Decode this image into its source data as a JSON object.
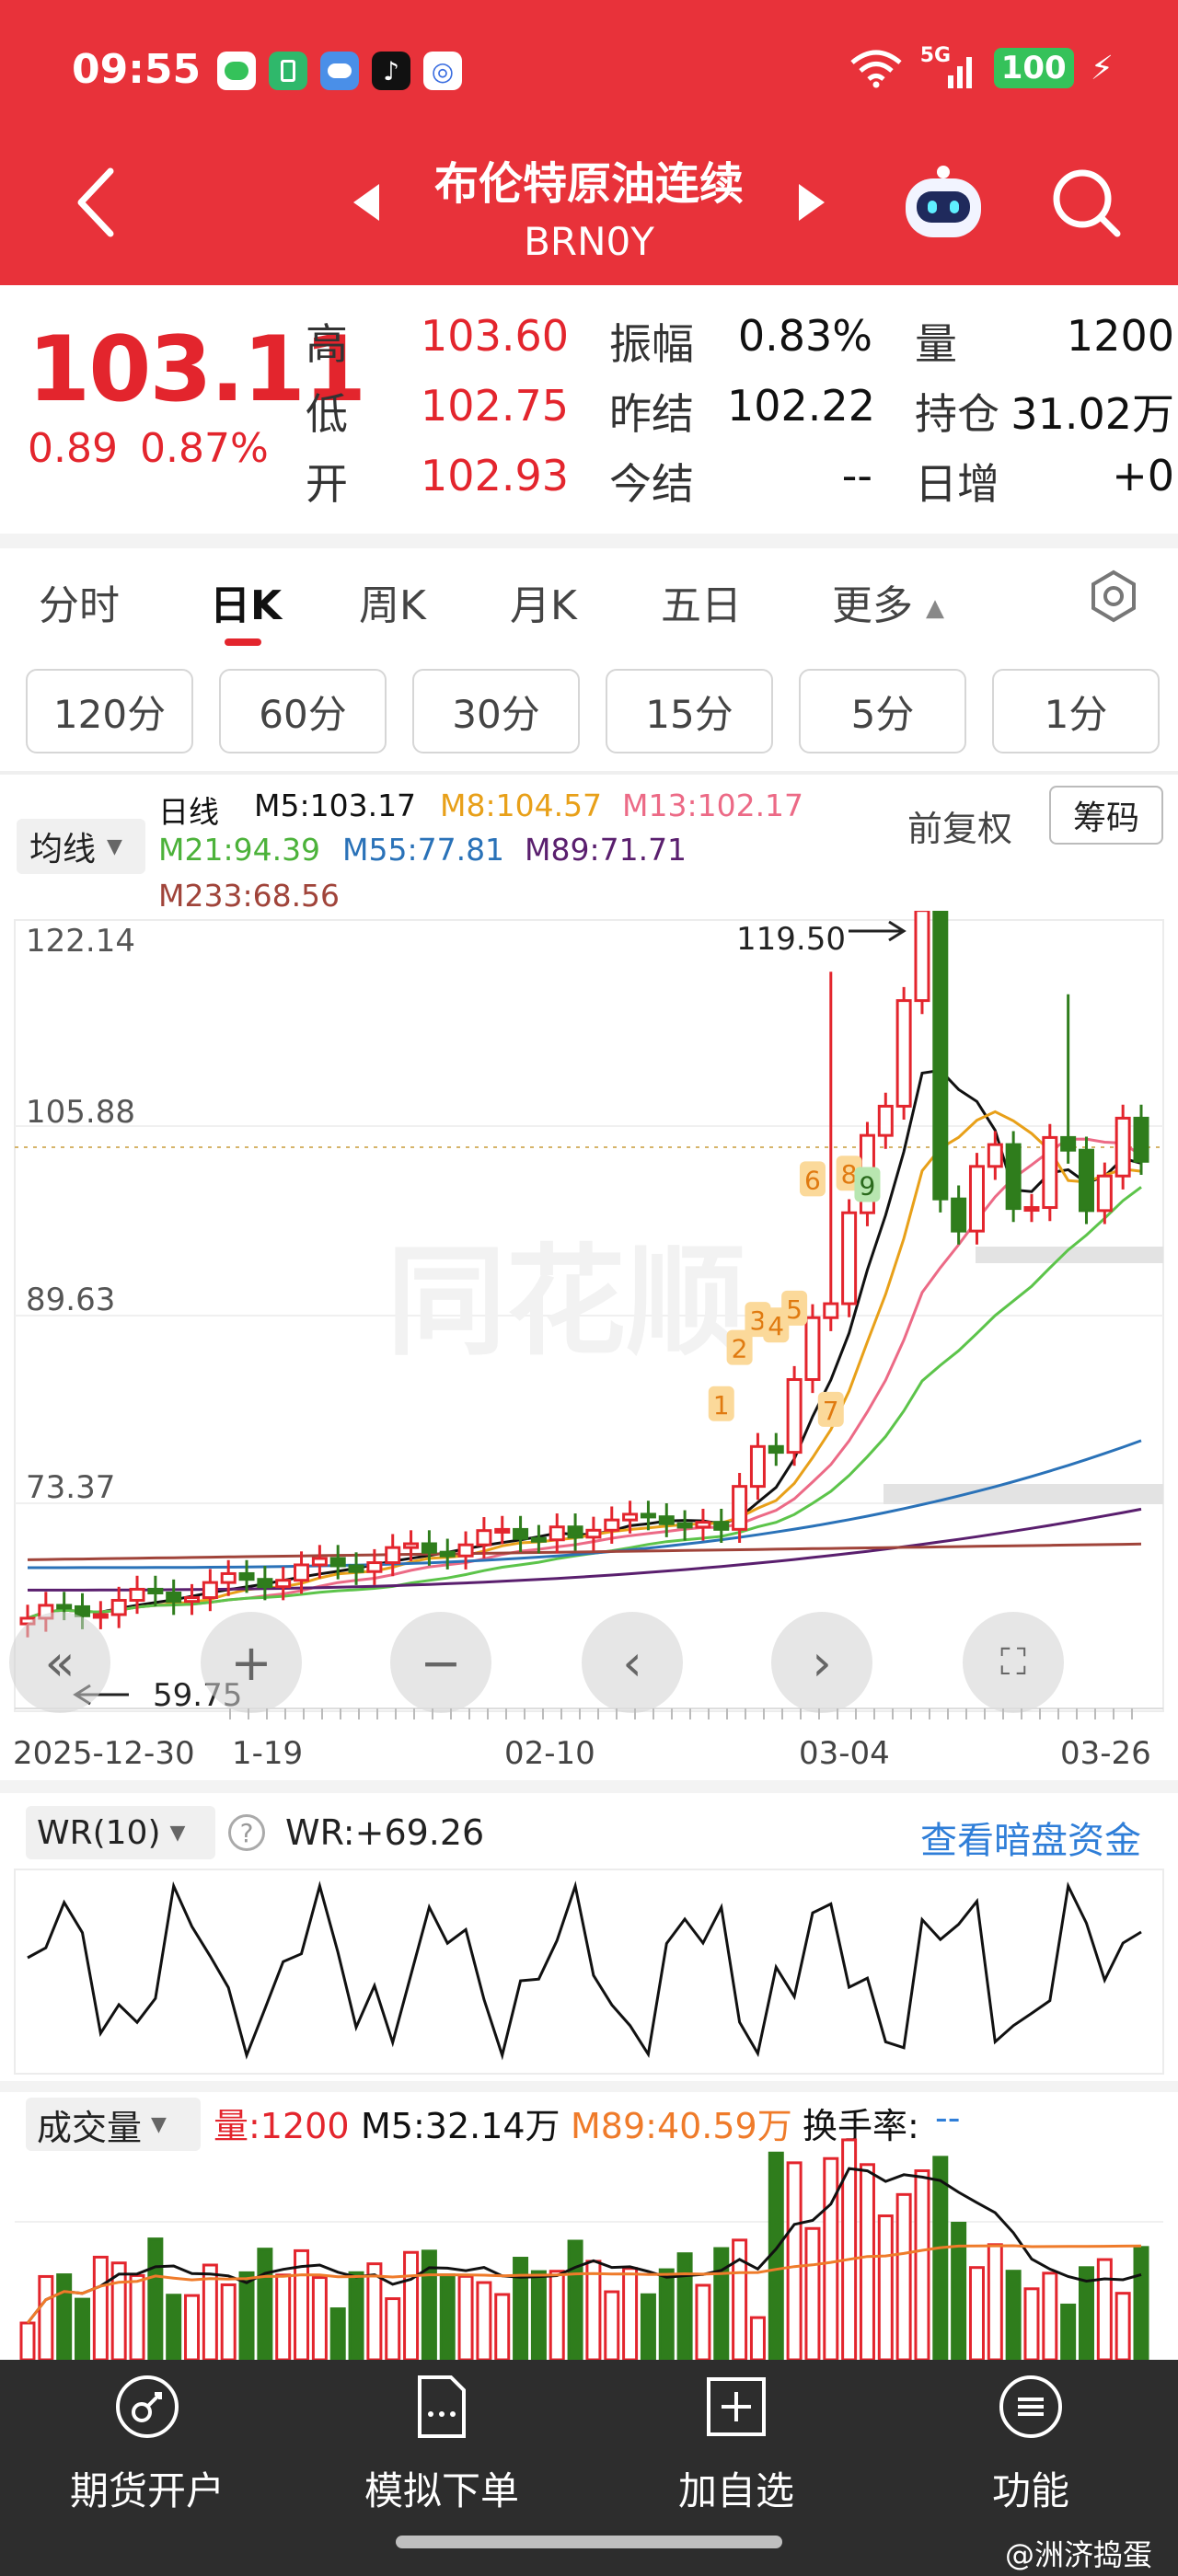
{
  "status_bar": {
    "time": "09:55",
    "network": "5G",
    "battery": "100"
  },
  "header": {
    "title": "布伦特原油连续",
    "code": "BRN0Y"
  },
  "quote": {
    "price": "103.11",
    "change": "0.89",
    "change_pct": "0.87%",
    "high_label": "高",
    "high": "103.60",
    "low_label": "低",
    "low": "102.75",
    "open_label": "开",
    "open": "102.93",
    "amplitude_label": "振幅",
    "amplitude": "0.83%",
    "prev_settle_label": "昨结",
    "prev_settle": "102.22",
    "today_settle_label": "今结",
    "today_settle": "--",
    "volume_label": "量",
    "volume": "1200",
    "open_interest_label": "持仓",
    "open_interest": "31.02万",
    "daily_inc_label": "日增",
    "daily_inc": "+0"
  },
  "tabs": [
    "分时",
    "日K",
    "周K",
    "月K",
    "五日",
    "更多"
  ],
  "periods": [
    "120分",
    "60分",
    "30分",
    "15分",
    "5分",
    "1分"
  ],
  "ma_legend": {
    "selector": "均线",
    "type": "日线",
    "m5": "M5:103.17",
    "m8": "M8:104.57",
    "m13": "M13:102.17",
    "m21": "M21:94.39",
    "m55": "M55:77.81",
    "m89": "M89:71.71",
    "m233": "M233:68.56",
    "adjust": "前复权",
    "chips": "筹码"
  },
  "colors": {
    "red": "#e3252d",
    "green": "#2f7d1c",
    "m5": "#111111",
    "m8": "#e8a019",
    "m13": "#ec6a86",
    "m21": "#5cc44a",
    "m55": "#2a72b8",
    "m89": "#5a1f6e",
    "m233": "#a0443a"
  },
  "chart": {
    "y_ticks": [
      "122.14",
      "105.88",
      "89.63",
      "73.37"
    ],
    "high_marker": "119.50",
    "low_marker": "59.75",
    "x_labels": [
      "2025-12-30",
      "1-19",
      "02-10",
      "03-04",
      "03-26"
    ],
    "watermark": "同花顺",
    "markers": [
      "1",
      "2",
      "3",
      "4",
      "5",
      "6",
      "7",
      "8",
      "9"
    ]
  },
  "wr": {
    "selector": "WR(10)",
    "value": "WR:+69.26",
    "link": "查看暗盘资金"
  },
  "volume": {
    "selector": "成交量",
    "vol": "量:1200",
    "m5": "M5:32.14万",
    "m89": "M89:40.59万",
    "turnover": "换手率:",
    "turnover_val": "--"
  },
  "bottom_nav": [
    "期货开户",
    "模拟下单",
    "加自选",
    "功能"
  ],
  "watermark_text": "@洲济捣蛋"
}
